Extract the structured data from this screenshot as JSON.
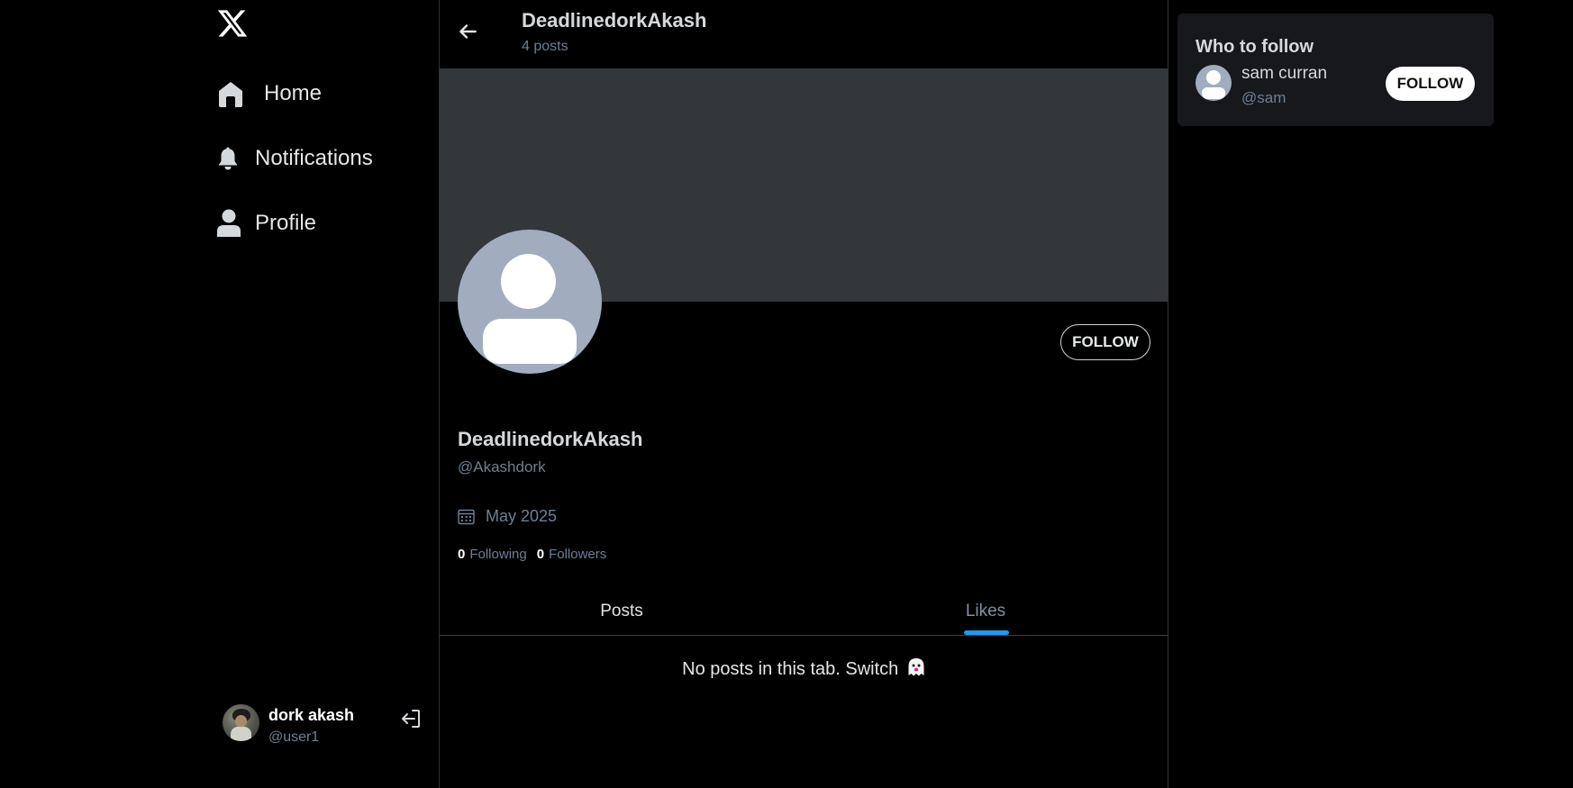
{
  "sidebar": {
    "logo": "x-logo",
    "items": [
      {
        "label": "Home",
        "icon": "home-icon"
      },
      {
        "label": "Notifications",
        "icon": "bell-icon"
      },
      {
        "label": "Profile",
        "icon": "user-icon"
      }
    ],
    "current_user": {
      "name": "dork akash",
      "handle": "@user1"
    }
  },
  "main": {
    "header": {
      "name": "DeadlinedorkAkash",
      "posts_count": "4 posts"
    },
    "profile": {
      "follow_label": "FOLLOW",
      "name": "DeadlinedorkAkash",
      "handle": "@Akashdork",
      "joined": "May 2025",
      "following_count": "0",
      "following_label": "Following",
      "followers_count": "0",
      "followers_label": "Followers"
    },
    "tabs": [
      {
        "label": "Posts",
        "active": false
      },
      {
        "label": "Likes",
        "active": true
      }
    ],
    "empty_message": "No posts in this tab. Switch"
  },
  "right_panel": {
    "title": "Who to follow",
    "suggestions": [
      {
        "name": "sam curran",
        "handle": "@sam",
        "follow_label": "FOLLOW"
      }
    ]
  },
  "colors": {
    "background": "#000000",
    "banner": "#343739",
    "accent": "#1d9bf0",
    "muted_text": "#6f7f93",
    "panel": "#16181c",
    "default_avatar": "#a1adbf"
  }
}
